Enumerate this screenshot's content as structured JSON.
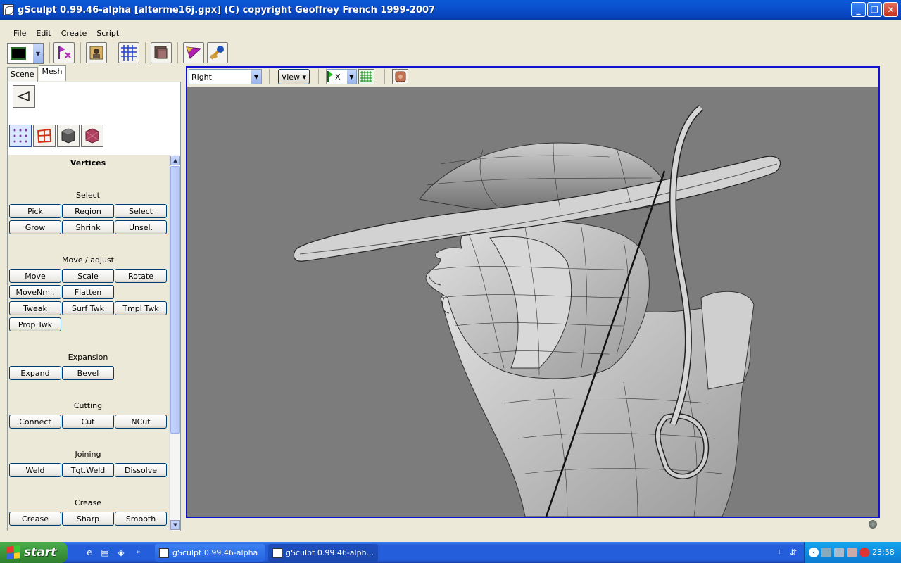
{
  "window": {
    "title": "gSculpt 0.99.46-alpha [alterme16j.gpx]  (C) copyright Geoffrey French 1999-2007",
    "controls": [
      "_",
      "❐",
      "✕"
    ]
  },
  "menu": [
    "File",
    "Edit",
    "Create",
    "Script"
  ],
  "toolbar": {
    "color_swatch": "#000000",
    "buttons": [
      "flag-x-icon",
      "portrait-icon",
      "grid-icon",
      "layers-icon",
      "triangle-tool-icon",
      "brush-icon"
    ]
  },
  "tabs": [
    {
      "label": "Scene",
      "active": false
    },
    {
      "label": "Mesh",
      "active": true
    }
  ],
  "panel": {
    "heading": "Vertices",
    "sections": [
      {
        "title": "Select",
        "buttons": [
          "Pick",
          "Region",
          "Select",
          "Grow",
          "Shrink",
          "Unsel."
        ]
      },
      {
        "title": "Move / adjust",
        "buttons": [
          "Move",
          "Scale",
          "Rotate",
          "MoveNml.",
          "Flatten",
          "Tweak",
          "Surf Twk",
          "Tmpl Twk",
          "Prop Twk"
        ]
      },
      {
        "title": "Expansion",
        "buttons": [
          "Expand",
          "Bevel"
        ]
      },
      {
        "title": "Cutting",
        "buttons": [
          "Connect",
          "Cut",
          "NCut"
        ]
      },
      {
        "title": "Joining",
        "buttons": [
          "Weld",
          "Tgt.Weld",
          "Dissolve"
        ]
      },
      {
        "title": "Crease",
        "buttons": [
          "Crease",
          "Sharp",
          "Smooth"
        ]
      }
    ]
  },
  "viewport": {
    "view_select": "Right",
    "view_menu": "View",
    "axis": "X",
    "background": "#7c7c7c"
  },
  "taskbar": {
    "start_label": "start",
    "tasks": [
      "gSculpt 0.99.46-alpha",
      "gSculpt 0.99.46-alph..."
    ],
    "clock": "23:58"
  }
}
